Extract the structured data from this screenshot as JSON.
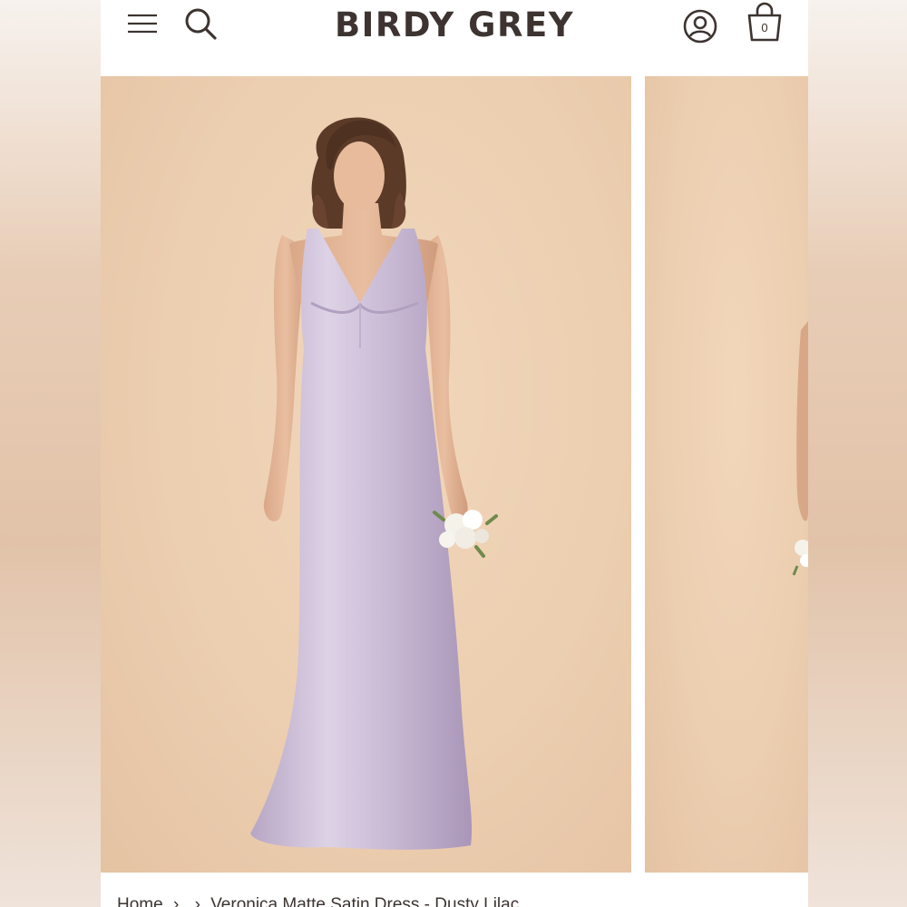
{
  "header": {
    "brand": "BIRDY GREY",
    "cart_count": "0",
    "icons": {
      "menu": "hamburger-menu-icon",
      "search": "search-icon",
      "account": "account-icon",
      "cart": "shopping-bag-icon"
    }
  },
  "gallery": {
    "slides": [
      {
        "subject": "model in lilac satin gown holding white bouquet"
      },
      {
        "subject": "next product image (partially visible)"
      }
    ]
  },
  "breadcrumb": {
    "home": "Home",
    "separator": "›",
    "category": "›",
    "current": "Veronica Matte Satin Dress - Dusty Lilac"
  },
  "colors": {
    "brand_text": "#3d3431",
    "backdrop": "#ecceb0",
    "dress": "#cbbcd6"
  }
}
